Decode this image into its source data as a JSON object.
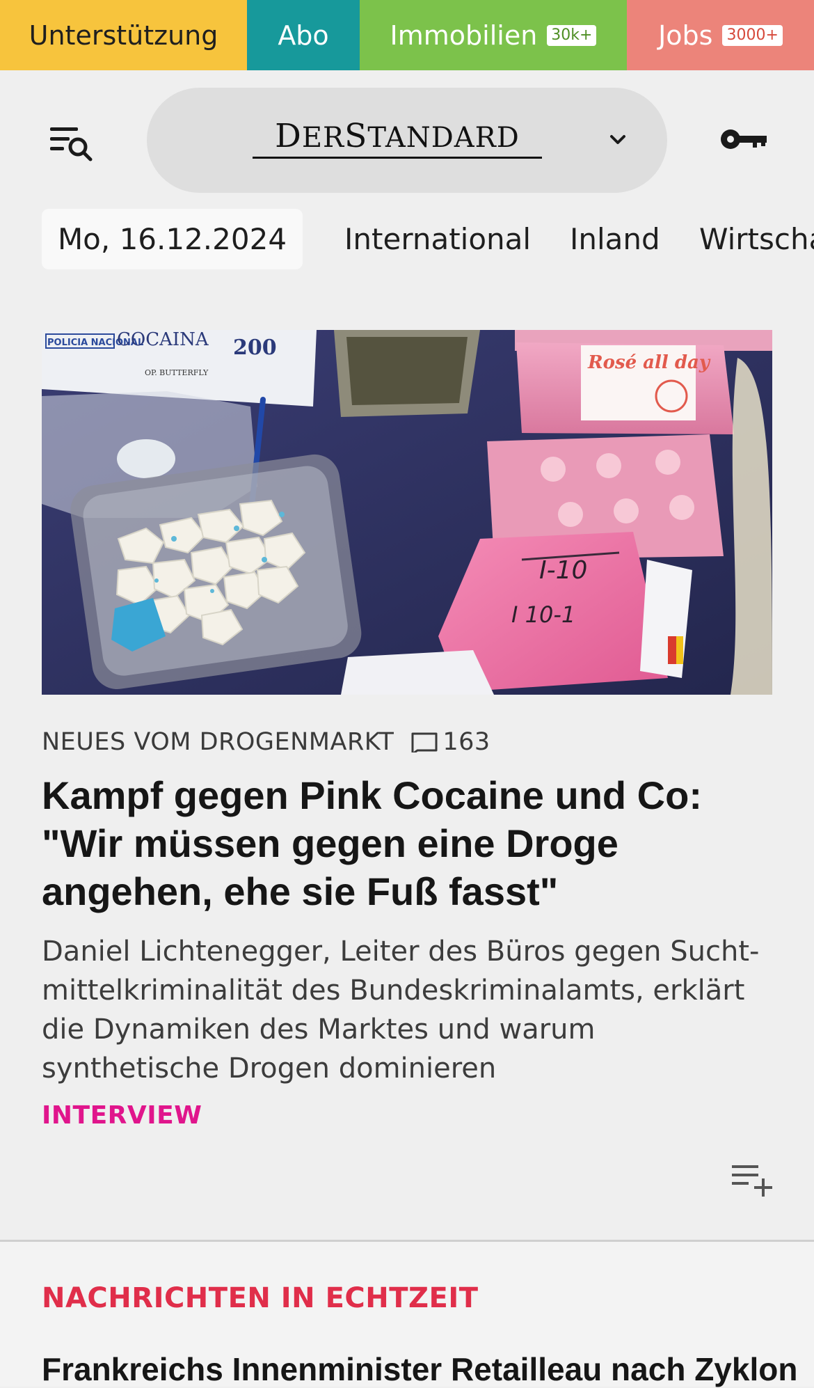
{
  "topbar": {
    "support_label": "Unterstützung",
    "abo_label": "Abo",
    "immo_label": "Immobilien",
    "immo_badge": "30k+",
    "jobs_label": "Jobs",
    "jobs_badge": "3000+"
  },
  "header": {
    "logo_text": "DerStandard",
    "icons": [
      "search-menu-icon",
      "chevron-down-icon",
      "key-icon"
    ]
  },
  "nav": {
    "date": "Mo, 16.12.2024",
    "items": [
      "International",
      "Inland",
      "Wirtscha"
    ]
  },
  "article": {
    "kicker": "NEUES VOM DROGENMARKT",
    "comment_count": "163",
    "headline": "Kampf gegen Pink Cocaine und Co: \"Wir müssen gegen eine Droge angehen, ehe sie Fuß fasst\"",
    "lead": "Daniel Lichtenegger, Leiter des Büros gegen Sucht-mittelkriminalität des Bundeskriminalamts, erklärt die Dynamiken des Marktes und warum synthetische Drogen dominieren",
    "type_label": "INTERVIEW",
    "image_labels": {
      "police_label": "POLICIA NACIONAL",
      "cocaina": "COCAINA",
      "number": "200",
      "operation": "OP. BUTTERFLY",
      "pink_label": "Rosé all day",
      "package_mark_1": "I-10",
      "package_mark_2": "I 10-1"
    }
  },
  "live": {
    "section_title": "NACHRICHTEN IN ECHTZEIT",
    "first_item": "Frankreichs Innenminister Retailleau nach Zyklon"
  },
  "colors": {
    "support": "#f7c43d",
    "abo": "#17999b",
    "immo": "#7cc24b",
    "jobs": "#ec847a",
    "interview": "#e0158c",
    "live_title": "#e02e4a"
  }
}
